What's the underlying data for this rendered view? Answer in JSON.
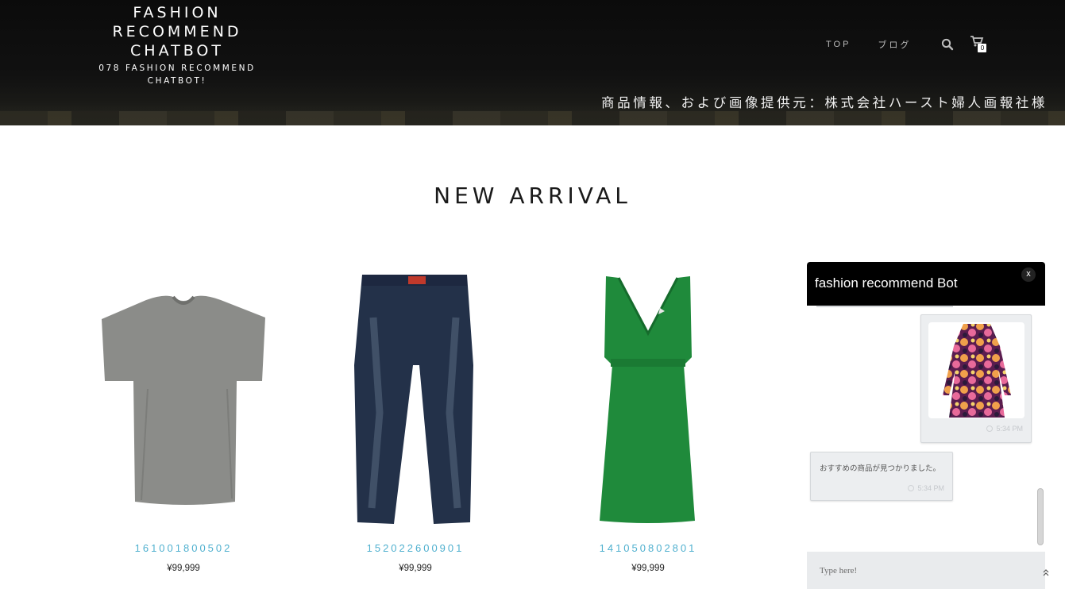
{
  "header": {
    "brand_title": "FASHION RECOMMEND CHATBOT",
    "brand_subtitle": "078 FASHION RECOMMEND CHATBOT!",
    "nav": [
      {
        "label": "TOP"
      },
      {
        "label": "ブログ"
      }
    ],
    "cart_count": "0",
    "credit": "商品情報、および画像提供元：株式会社ハースト婦人画報社様"
  },
  "main": {
    "section_title": "NEW ARRIVAL",
    "products": [
      {
        "sku": "161001800502",
        "price": "¥99,999",
        "image": "gray-tshirt"
      },
      {
        "sku": "152022600901",
        "price": "¥99,999",
        "image": "denim-jeans"
      },
      {
        "sku": "141050802801",
        "price": "¥99,999",
        "image": "green-dress"
      }
    ]
  },
  "chat": {
    "title": "fashion recommend Bot",
    "close_label": "x",
    "messages": [
      {
        "type": "image",
        "image": "floral-dress",
        "time": "5:34 PM"
      },
      {
        "type": "text",
        "text": "おすすめの商品が見つかりました。",
        "time": "5:34 PM"
      }
    ],
    "input_placeholder": "Type here!"
  },
  "colors": {
    "header_bg": "#0b0b0b",
    "sku_link": "#4fb0cf",
    "chat_header": "#000000",
    "bubble_bg": "#eceef0"
  }
}
